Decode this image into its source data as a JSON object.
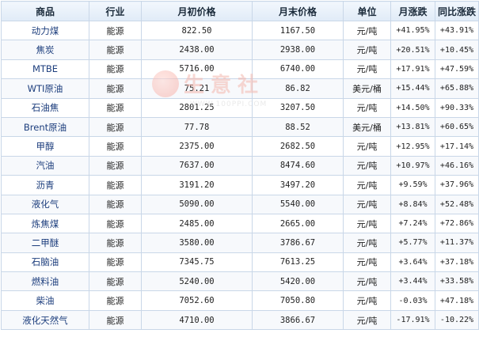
{
  "table": {
    "headers": [
      "商品",
      "行业",
      "月初价格",
      "月末价格",
      "单位",
      "月涨跌",
      "同比涨跌"
    ],
    "rows": [
      {
        "name": "动力煤",
        "industry": "能源",
        "start": "822.50",
        "end": "1167.50",
        "unit": "元/吨",
        "month": "+41.95%",
        "yoy": "+43.91%"
      },
      {
        "name": "焦炭",
        "industry": "能源",
        "start": "2438.00",
        "end": "2938.00",
        "unit": "元/吨",
        "month": "+20.51%",
        "yoy": "+10.45%"
      },
      {
        "name": "MTBE",
        "industry": "能源",
        "start": "5716.00",
        "end": "6740.00",
        "unit": "元/吨",
        "month": "+17.91%",
        "yoy": "+47.59%"
      },
      {
        "name": "WTI原油",
        "industry": "能源",
        "start": "75.21",
        "end": "86.82",
        "unit": "美元/桶",
        "month": "+15.44%",
        "yoy": "+65.88%"
      },
      {
        "name": "石油焦",
        "industry": "能源",
        "start": "2801.25",
        "end": "3207.50",
        "unit": "元/吨",
        "month": "+14.50%",
        "yoy": "+90.33%"
      },
      {
        "name": "Brent原油",
        "industry": "能源",
        "start": "77.78",
        "end": "88.52",
        "unit": "美元/桶",
        "month": "+13.81%",
        "yoy": "+60.65%"
      },
      {
        "name": "甲醇",
        "industry": "能源",
        "start": "2375.00",
        "end": "2682.50",
        "unit": "元/吨",
        "month": "+12.95%",
        "yoy": "+17.14%"
      },
      {
        "name": "汽油",
        "industry": "能源",
        "start": "7637.00",
        "end": "8474.60",
        "unit": "元/吨",
        "month": "+10.97%",
        "yoy": "+46.16%"
      },
      {
        "name": "沥青",
        "industry": "能源",
        "start": "3191.20",
        "end": "3497.20",
        "unit": "元/吨",
        "month": "+9.59%",
        "yoy": "+37.96%"
      },
      {
        "name": "液化气",
        "industry": "能源",
        "start": "5090.00",
        "end": "5540.00",
        "unit": "元/吨",
        "month": "+8.84%",
        "yoy": "+52.48%"
      },
      {
        "name": "炼焦煤",
        "industry": "能源",
        "start": "2485.00",
        "end": "2665.00",
        "unit": "元/吨",
        "month": "+7.24%",
        "yoy": "+72.86%"
      },
      {
        "name": "二甲醚",
        "industry": "能源",
        "start": "3580.00",
        "end": "3786.67",
        "unit": "元/吨",
        "month": "+5.77%",
        "yoy": "+11.37%"
      },
      {
        "name": "石脑油",
        "industry": "能源",
        "start": "7345.75",
        "end": "7613.25",
        "unit": "元/吨",
        "month": "+3.64%",
        "yoy": "+37.18%"
      },
      {
        "name": "燃料油",
        "industry": "能源",
        "start": "5240.00",
        "end": "5420.00",
        "unit": "元/吨",
        "month": "+3.44%",
        "yoy": "+33.58%"
      },
      {
        "name": "柴油",
        "industry": "能源",
        "start": "7052.60",
        "end": "7050.80",
        "unit": "元/吨",
        "month": "-0.03%",
        "yoy": "+47.18%"
      },
      {
        "name": "液化天然气",
        "industry": "能源",
        "start": "4710.00",
        "end": "3866.67",
        "unit": "元/吨",
        "month": "-17.91%",
        "yoy": "-10.22%"
      }
    ]
  },
  "watermark": {
    "brand": "生意社",
    "url": "WWW.100PPI.COM"
  },
  "colors": {
    "positive": "#e00000",
    "negative": "#008000",
    "name_link": "#1d3e7d",
    "border": "#c9d7e8"
  }
}
